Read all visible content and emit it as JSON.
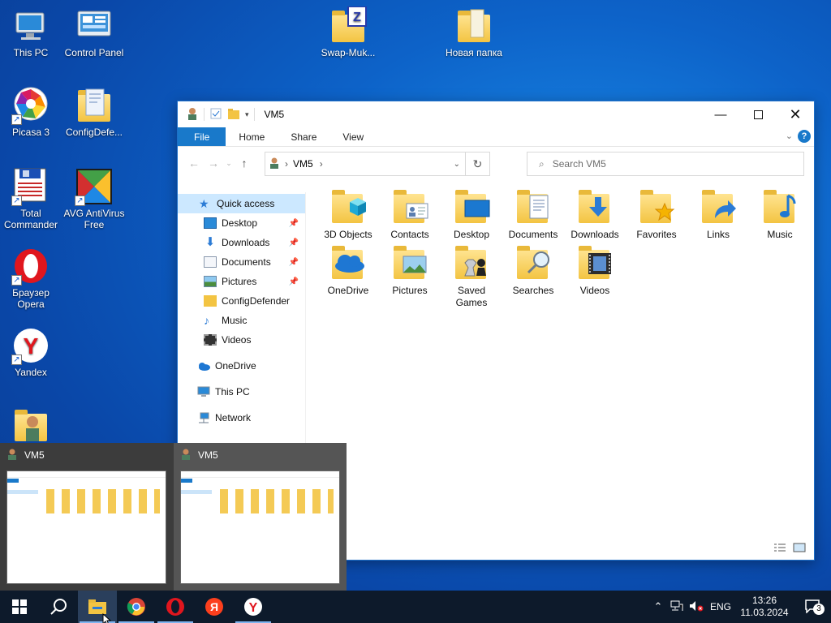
{
  "desktop": {
    "icons": [
      {
        "label": "This PC",
        "icon": "this-pc-icon"
      },
      {
        "label": "Control Panel",
        "icon": "control-panel-icon"
      },
      {
        "label": "Swap-Muk...",
        "icon": "archive-icon"
      },
      {
        "label": "Новая папка",
        "icon": "folder-icon"
      },
      {
        "label": "Picasa 3",
        "icon": "picasa-icon"
      },
      {
        "label": "ConfigDefe...",
        "icon": "folder-icon"
      },
      {
        "label": "Total Commander",
        "icon": "total-commander-icon"
      },
      {
        "label": "AVG AntiVirus Free",
        "icon": "avg-icon"
      },
      {
        "label": "Браузер Opera",
        "icon": "opera-icon"
      },
      {
        "label": "Yandex",
        "icon": "yandex-icon"
      }
    ]
  },
  "explorer": {
    "title": "VM5",
    "ribbon_tabs": [
      "File",
      "Home",
      "Share",
      "View"
    ],
    "address": {
      "crumb": "VM5"
    },
    "search_placeholder": "Search VM5",
    "nav": {
      "quick_access": "Quick access",
      "pinned": [
        "Desktop",
        "Downloads",
        "Documents",
        "Pictures"
      ],
      "others": [
        "ConfigDefender",
        "Music",
        "Videos"
      ],
      "onedrive": "OneDrive",
      "this_pc": "This PC",
      "network": "Network"
    },
    "items": [
      {
        "label": "3D Objects",
        "icon": "3d-objects-icon"
      },
      {
        "label": "Contacts",
        "icon": "contacts-icon"
      },
      {
        "label": "Desktop",
        "icon": "desktop-folder-icon"
      },
      {
        "label": "Documents",
        "icon": "documents-icon"
      },
      {
        "label": "Downloads",
        "icon": "downloads-icon"
      },
      {
        "label": "Favorites",
        "icon": "favorites-icon"
      },
      {
        "label": "Links",
        "icon": "links-icon"
      },
      {
        "label": "Music",
        "icon": "music-icon"
      },
      {
        "label": "OneDrive",
        "icon": "onedrive-icon"
      },
      {
        "label": "Pictures",
        "icon": "pictures-icon"
      },
      {
        "label": "Saved Games",
        "icon": "saved-games-icon"
      },
      {
        "label": "Searches",
        "icon": "searches-icon"
      },
      {
        "label": "Videos",
        "icon": "videos-icon"
      }
    ]
  },
  "thumbnails": [
    {
      "title": "VM5"
    },
    {
      "title": "VM5"
    }
  ],
  "taskbar": {
    "apps": [
      "start-icon",
      "search-icon",
      "file-explorer-icon",
      "chrome-icon",
      "opera-icon",
      "yandex-browser-icon",
      "yandex-icon"
    ],
    "tray": {
      "language": "ENG",
      "time": "13:26",
      "date": "11.03.2024",
      "notification_count": "3"
    }
  },
  "colors": {
    "accent": "#1979ca",
    "selection": "#cce8ff",
    "taskbar": "#0d1a2b",
    "folder": "#f3c442"
  }
}
